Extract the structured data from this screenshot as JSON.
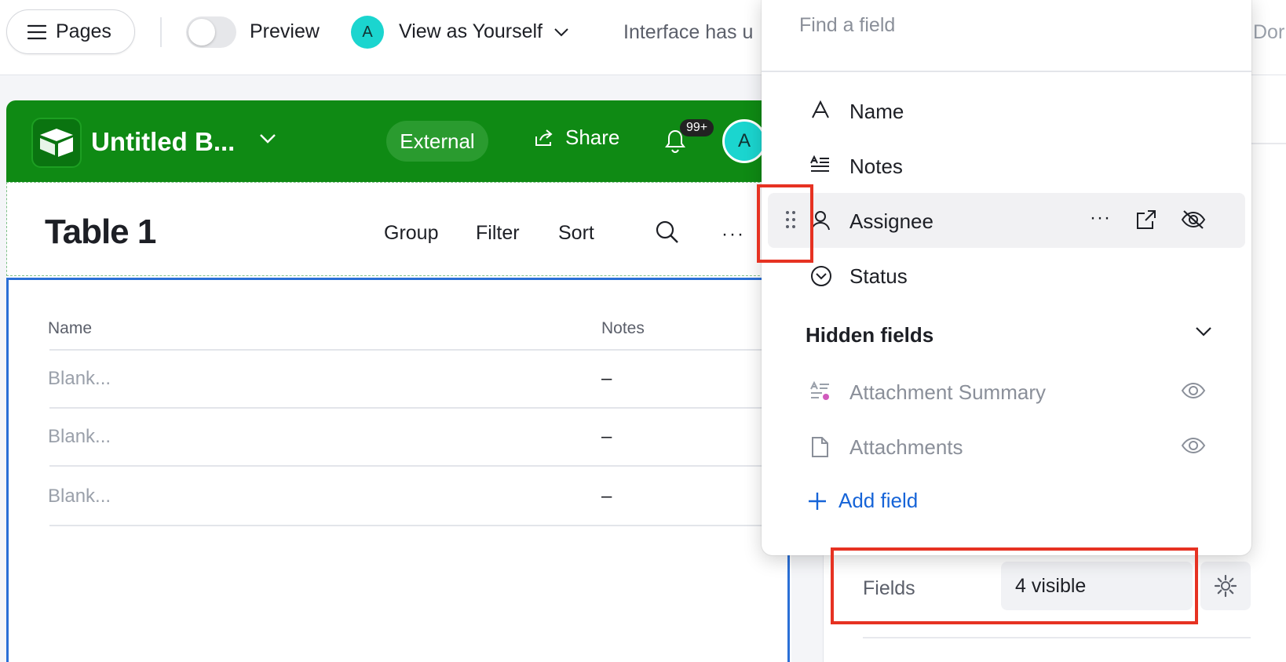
{
  "topbar": {
    "pages_label": "Pages",
    "preview_label": "Preview",
    "preview_on": false,
    "viewer_initial": "A",
    "view_as_label": "View as Yourself",
    "interface_message": "Interface has u",
    "done_label": "Dor"
  },
  "app": {
    "base_title": "Untitled B...",
    "external_label": "External",
    "share_label": "Share",
    "notification_count": "99+",
    "user_initial": "A",
    "colors": {
      "header": "#0f8a14",
      "accent": "#1bd5cf"
    }
  },
  "table": {
    "title": "Table 1",
    "tools": {
      "group": "Group",
      "filter": "Filter",
      "sort": "Sort"
    },
    "columns": [
      "Name",
      "Notes"
    ],
    "rows": [
      {
        "name": "Blank...",
        "notes": "–"
      },
      {
        "name": "Blank...",
        "notes": "–"
      },
      {
        "name": "Blank...",
        "notes": "–"
      }
    ]
  },
  "popover": {
    "search_placeholder": "Find a field",
    "visible_fields": [
      {
        "label": "Name",
        "icon": "text-icon"
      },
      {
        "label": "Notes",
        "icon": "long-text-icon"
      },
      {
        "label": "Assignee",
        "icon": "user-icon"
      },
      {
        "label": "Status",
        "icon": "single-select-icon"
      }
    ],
    "hidden_fields_heading": "Hidden fields",
    "hidden_fields": [
      {
        "label": "Attachment Summary",
        "icon": "ai-text-icon"
      },
      {
        "label": "Attachments",
        "icon": "file-icon"
      }
    ],
    "add_field_label": "Add field"
  },
  "properties": {
    "fields_label": "Fields",
    "fields_value": "4 visible"
  }
}
